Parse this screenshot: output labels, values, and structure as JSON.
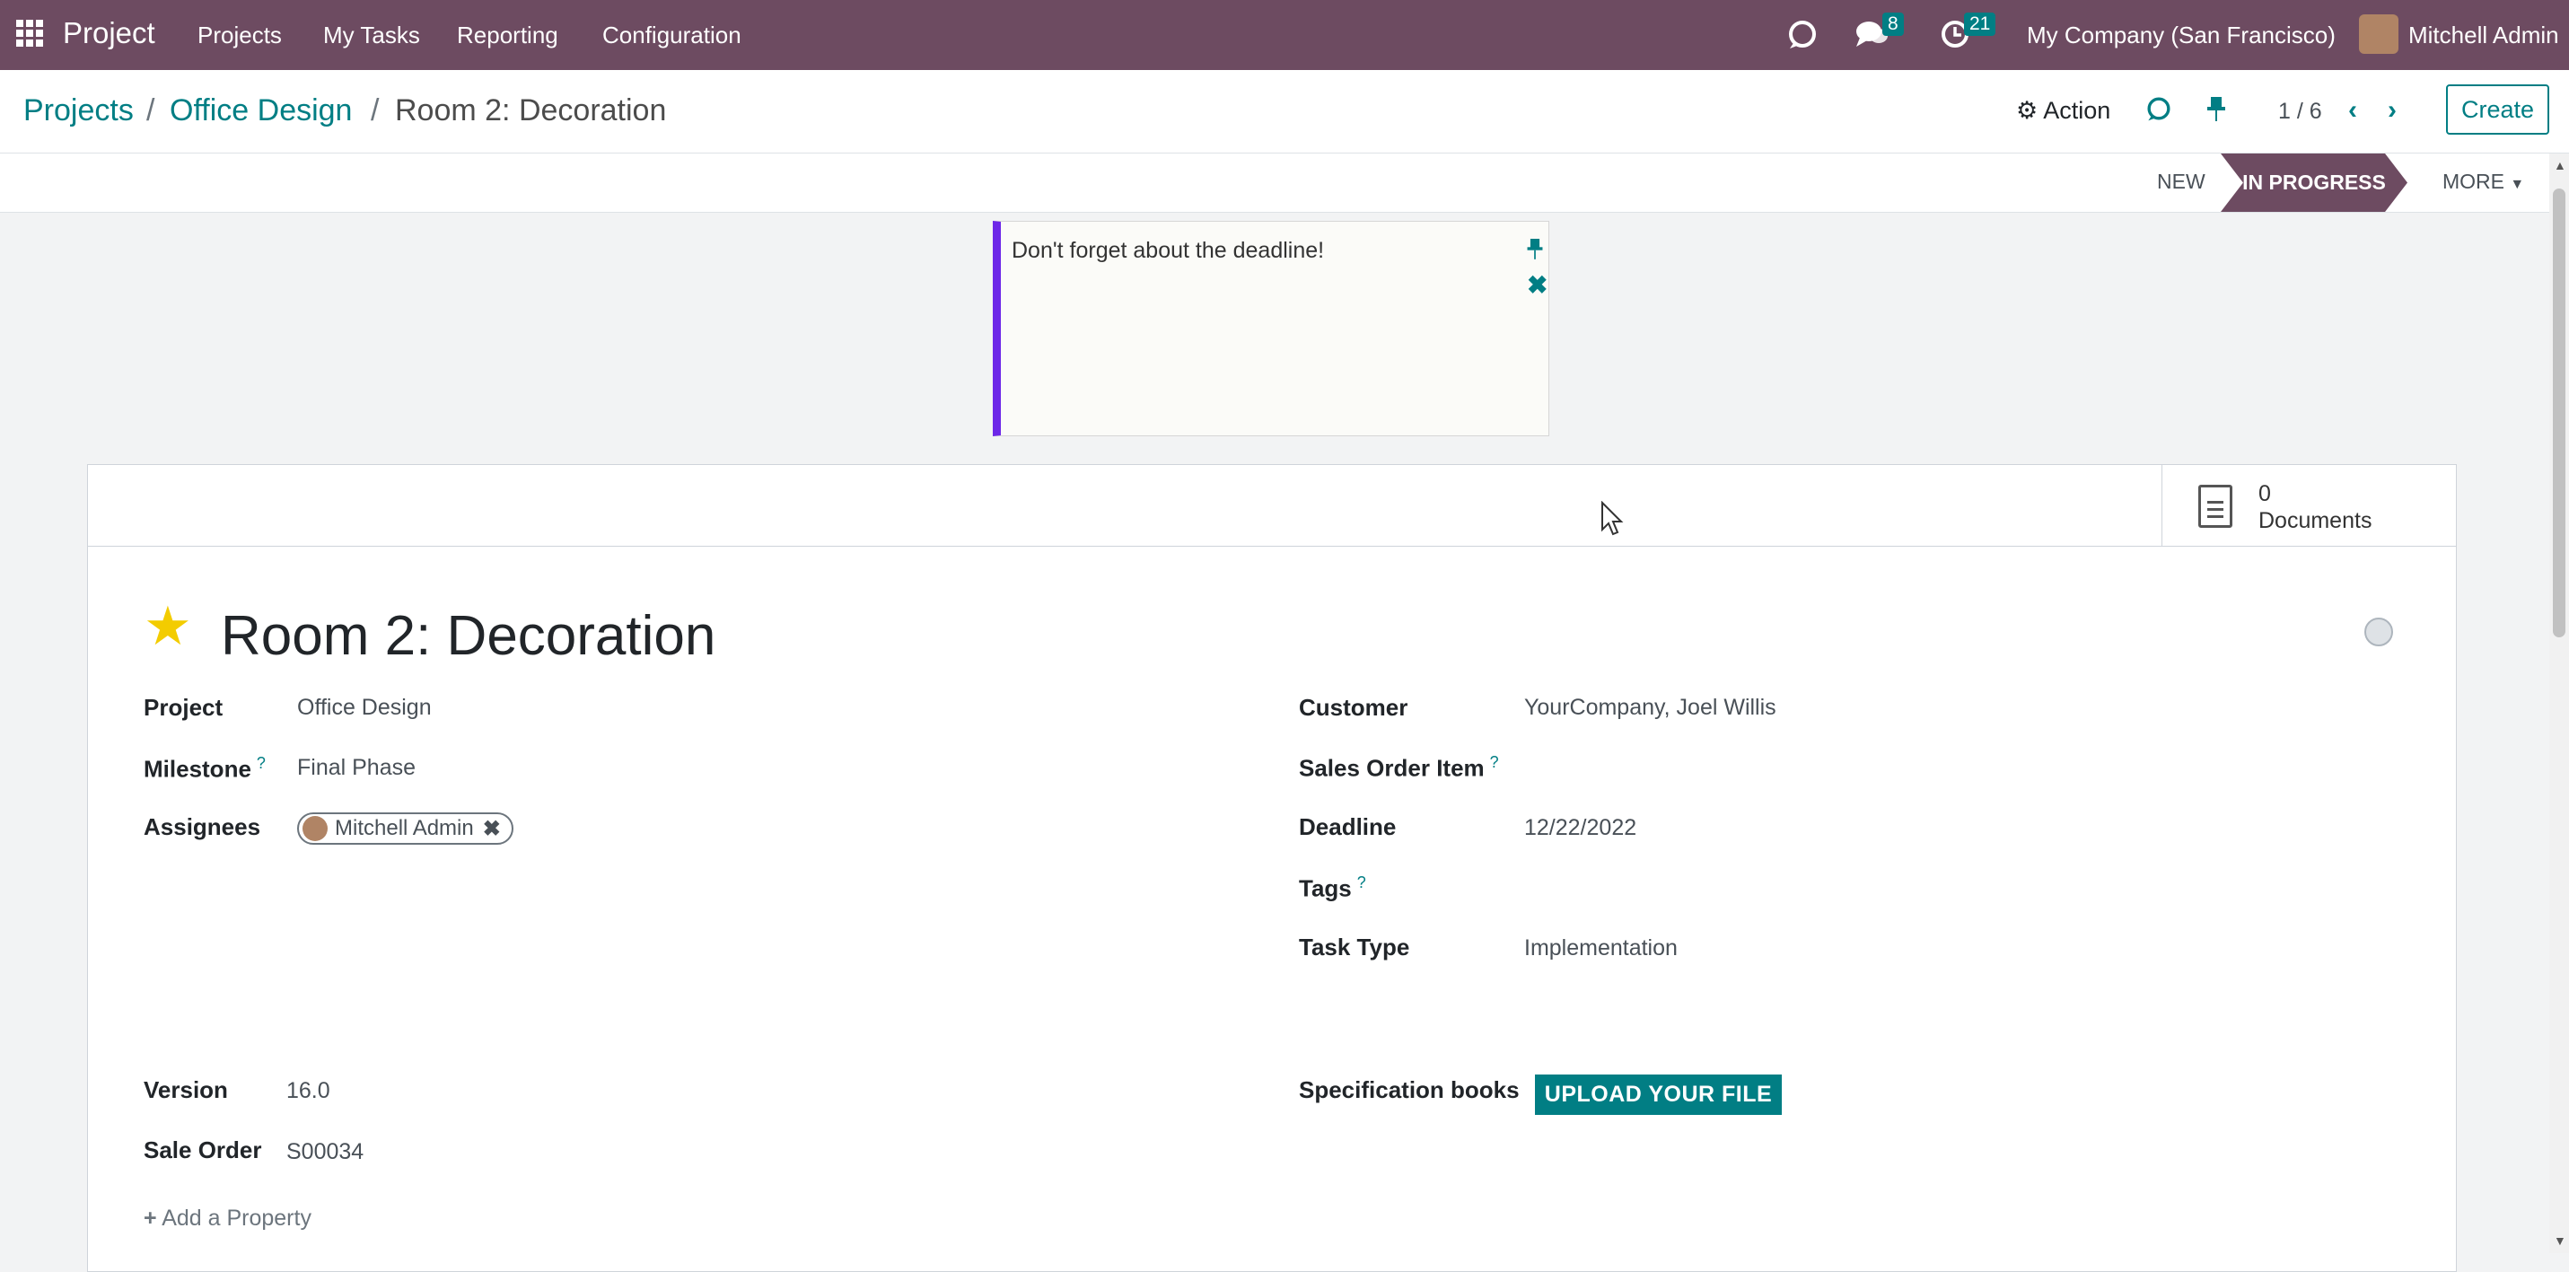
{
  "topbar": {
    "app_name": "Project",
    "menu": [
      "Projects",
      "My Tasks",
      "Reporting",
      "Configuration"
    ],
    "messages_count": "8",
    "activities_count": "21",
    "company": "My Company (San Francisco)",
    "user": "Mitchell Admin"
  },
  "breadcrumb": {
    "root": "Projects",
    "sep": "/",
    "project": "Office Design",
    "current": "Room 2: Decoration"
  },
  "control": {
    "action_label": "Action",
    "pager": "1 / 6",
    "create_label": "Create"
  },
  "statusbar": {
    "stages": [
      "NEW",
      "IN PROGRESS"
    ],
    "active_stage": "IN PROGRESS",
    "more_label": "MORE"
  },
  "note": {
    "text": "Don't forget about the deadline!"
  },
  "stat": {
    "documents_count": "0",
    "documents_label": "Documents"
  },
  "task": {
    "title": "Room 2: Decoration",
    "fields_left": {
      "project_label": "Project",
      "project": "Office Design",
      "milestone_label": "Milestone",
      "milestone": "Final Phase",
      "assignees_label": "Assignees",
      "assignee": "Mitchell Admin",
      "version_label": "Version",
      "version": "16.0",
      "sale_order_label": "Sale Order",
      "sale_order": "S00034"
    },
    "fields_right": {
      "customer_label": "Customer",
      "customer": "YourCompany, Joel Willis",
      "sales_order_item_label": "Sales Order Item",
      "deadline_label": "Deadline",
      "deadline": "12/22/2022",
      "tags_label": "Tags",
      "task_type_label": "Task Type",
      "task_type": "Implementation",
      "spec_books_label": "Specification books",
      "upload_label": "UPLOAD YOUR FILE"
    },
    "help_mark": "?",
    "add_property": "Add a Property"
  },
  "colors": {
    "navbar": "#6d4b61",
    "accent": "#017e84",
    "note_border": "#6d27e8",
    "star": "#f3cc00"
  }
}
